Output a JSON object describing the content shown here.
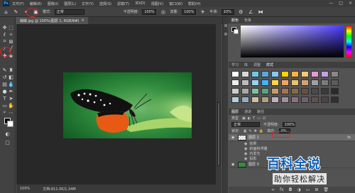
{
  "menubar": {
    "logo": "Ps",
    "items": [
      "文件(F)",
      "编辑(E)",
      "图像(I)",
      "图层(L)",
      "文字(Y)",
      "选择(S)",
      "滤镜(T)",
      "3D(D)",
      "视图(V)",
      "窗口(W)",
      "帮助(H)"
    ],
    "controls": [
      "—",
      "□",
      "×"
    ]
  },
  "options": {
    "mode_label": "模式:",
    "mode_value": "正常",
    "opacity_label": "不透明度:",
    "opacity_value": "100%",
    "flow_label": "流量:",
    "flow_value": "100%",
    "smooth_label": "平滑:",
    "smooth_value": "10%"
  },
  "document": {
    "tab_title": "蝴蝶.jpg @ 100%(图层 1, RGB/8#)",
    "close": "×",
    "status_zoom": "100%",
    "status_doc": "文档:811.0K/1.34M"
  },
  "color_panel": {
    "tabs": [
      "颜色",
      "色板"
    ],
    "accent": "#4c3cff"
  },
  "swatch_panel": {
    "tabs": [
      "学习",
      "库",
      "调整",
      "样式"
    ],
    "colors": [
      "#ffffff",
      "#d9d9d9",
      "#6fc8e6",
      "#5aa9d8",
      "#8cc6ee",
      "#ffd400",
      "#ffb43b",
      "#f7c77a",
      "#e39bd6",
      "#c3a0e3",
      "#888888",
      "#eeeeee",
      "#bcbcbc",
      "#9bd1f0",
      "#44b3ff",
      "#ffd54a",
      "#f4a261",
      "#e9c46a",
      "#d4a373",
      "#a0a0a0",
      "#7b7b7b",
      "#5c5c5c",
      "#cccccc",
      "#a8a8a8",
      "#7fbfa0",
      "#5aa37a",
      "#c99b6b",
      "#a3764b",
      "#8b6a4a",
      "#6a5040",
      "#4a4a4a",
      "#3a3a3a",
      "#2a2a2a",
      "#b0d0e0",
      "#8fb0c0",
      "#d0c0a0",
      "#b0a080",
      "#c0b0c0",
      "#a090a0",
      "#907080",
      "#706070",
      "#605050",
      "#504040",
      "#303030"
    ]
  },
  "layers_panel": {
    "tabs": [
      "图层",
      "通道",
      "路径"
    ],
    "kind_label": "类型",
    "blend_mode": "正常",
    "opacity_label": "不透明度:",
    "opacity_value": "100%",
    "lock_label": "锁定:",
    "fill_label": "填充:",
    "fill_value": "0%",
    "layers": [
      {
        "name": "图层 1",
        "selected": true,
        "fx": "fx"
      },
      {
        "name": "图层 0",
        "selected": false
      }
    ],
    "effects": [
      "效果",
      "斜面和浮雕",
      "内发光",
      "投影"
    ]
  },
  "watermark": {
    "title": "百科全说",
    "subtitle": "助你轻松解决"
  }
}
